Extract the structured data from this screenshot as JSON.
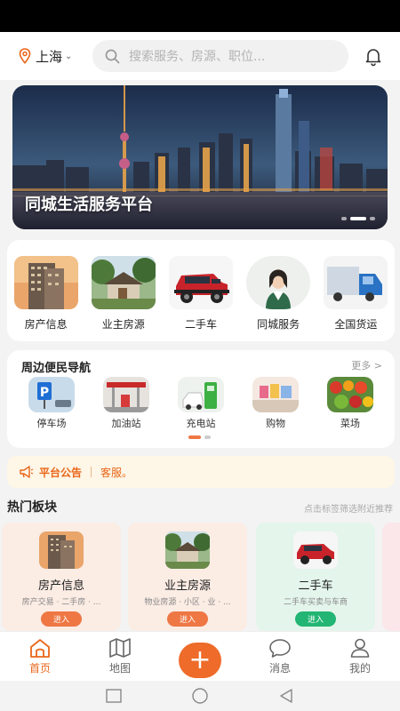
{
  "header": {
    "city": "上海",
    "search_placeholder": "搜索服务、房源、职位...",
    "bell_icon": "bell-icon",
    "location_icon": "location-pin-icon"
  },
  "banner": {
    "title": "同城生活服务平台",
    "slides": 3,
    "active_slide": 2
  },
  "categories": [
    {
      "label": "房产信息",
      "icon": "building-photo"
    },
    {
      "label": "业主房源",
      "icon": "garden-house-photo"
    },
    {
      "label": "二手车",
      "icon": "red-car-photo"
    },
    {
      "label": "同城服务",
      "icon": "service-staff-photo"
    },
    {
      "label": "全国货运",
      "icon": "truck-photo"
    }
  ],
  "nearby": {
    "title": "周边便民导航",
    "more": "更多 >",
    "items": [
      {
        "label": "停车场"
      },
      {
        "label": "加油站"
      },
      {
        "label": "充电站"
      },
      {
        "label": "购物"
      },
      {
        "label": "菜场"
      }
    ]
  },
  "notice": {
    "title": "平台公告",
    "text": "客服。"
  },
  "hot": {
    "title": "热门板块",
    "hint": "点击标签筛选附近推荐",
    "cards": [
      {
        "title": "房产信息",
        "sub": "房产交易 · 二手房 · ...",
        "button": "进入",
        "color": "#ee7744",
        "bg": "#fdeee6"
      },
      {
        "title": "业主房源",
        "sub": "物业房源 · 小区 · 业 · ...",
        "button": "进入",
        "color": "#ee7744",
        "bg": "#fdeee6"
      },
      {
        "title": "二手车",
        "sub": "二手车买卖与车商",
        "button": "进入",
        "color": "#22b573",
        "bg": "#e6f6ee"
      }
    ]
  },
  "tabbar": {
    "items": [
      {
        "label": "首页",
        "icon": "home-icon"
      },
      {
        "label": "地图",
        "icon": "map-icon"
      },
      {
        "label": "",
        "icon": "plus-icon"
      },
      {
        "label": "消息",
        "icon": "message-icon"
      },
      {
        "label": "我的",
        "icon": "user-icon"
      }
    ],
    "active": 0
  },
  "colors": {
    "accent": "#ee6b2a",
    "notice_bg": "#fef6e6"
  }
}
